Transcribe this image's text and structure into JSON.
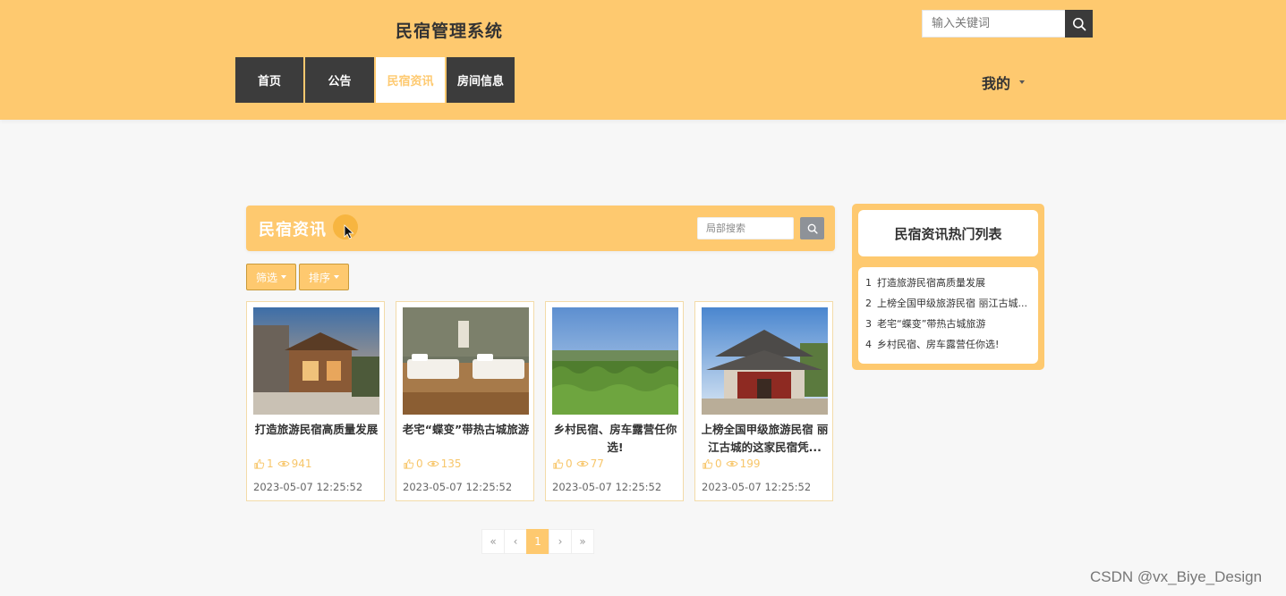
{
  "header": {
    "site_title": "民宿管理系统",
    "search_placeholder": "输入关键词",
    "nav": [
      {
        "label": "首页"
      },
      {
        "label": "公告"
      },
      {
        "label": "民宿资讯"
      },
      {
        "label": "房间信息"
      }
    ],
    "active_nav": "民宿资讯",
    "my_menu_label": "我的"
  },
  "main": {
    "panel_title": "民宿资讯",
    "local_search_placeholder": "局部搜索",
    "filter_label": "筛选",
    "sort_label": "排序",
    "cards": [
      {
        "title": "打造旅游民宿高质量发展",
        "likes": "1",
        "views": "941",
        "date": "2023-05-07 12:25:52"
      },
      {
        "title": "老宅“蝶变”带热古城旅游",
        "likes": "0",
        "views": "135",
        "date": "2023-05-07 12:25:52"
      },
      {
        "title": "乡村民宿、房车露营任你选!",
        "likes": "0",
        "views": "77",
        "date": "2023-05-07 12:25:52"
      },
      {
        "title": "上榜全国甲级旅游民宿 丽江古城的这家民宿凭...",
        "likes": "0",
        "views": "199",
        "date": "2023-05-07 12:25:52"
      }
    ],
    "pagination": {
      "first": "«",
      "prev": "‹",
      "current": "1",
      "next": "›",
      "last": "»"
    }
  },
  "sidebar": {
    "title": "民宿资讯热门列表",
    "items": [
      {
        "num": "1",
        "text": "打造旅游民宿高质量发展"
      },
      {
        "num": "2",
        "text": "上榜全国甲级旅游民宿 丽江古城..."
      },
      {
        "num": "3",
        "text": "老宅“蝶变”带热古城旅游"
      },
      {
        "num": "4",
        "text": "乡村民宿、房车露营任你选!"
      }
    ]
  },
  "watermark": "CSDN @vx_Biye_Design",
  "colors": {
    "accent": "#fec96f",
    "nav_dark": "#3c3c3c",
    "stats": "#f7c66a"
  },
  "icons": [
    "search-icon",
    "cursor-icon",
    "like-icon",
    "eye-icon",
    "chevron-down-icon"
  ]
}
